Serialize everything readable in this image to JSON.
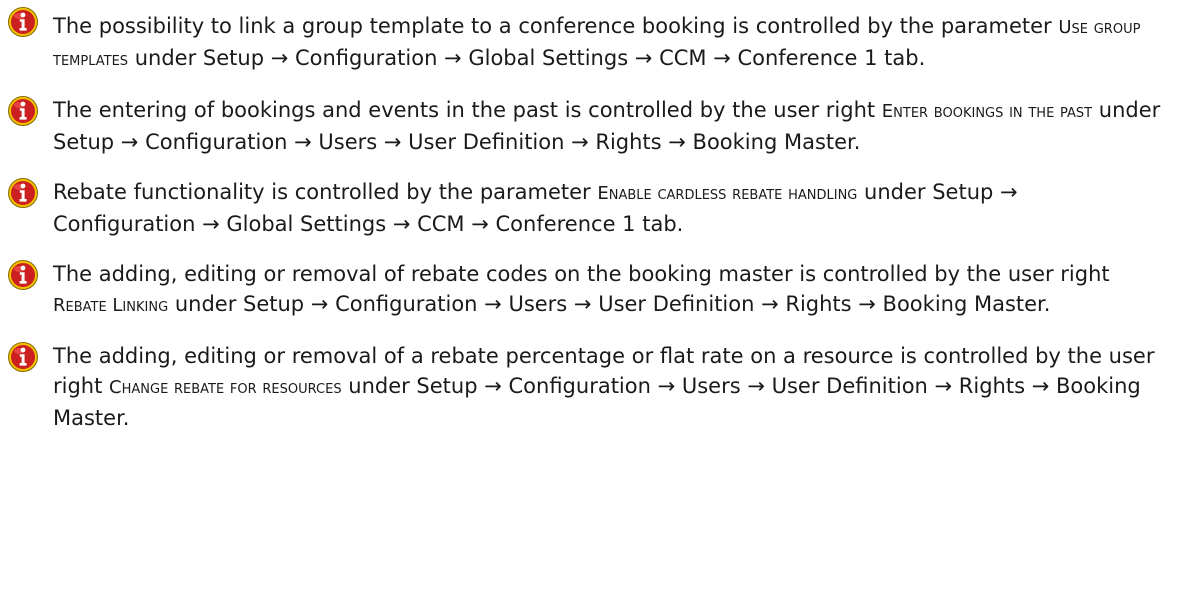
{
  "notes": [
    {
      "icon": "info-icon",
      "before": "The possibility to link a group template to a conference booking is controlled by the parameter ",
      "term": "Use group templates",
      "after": " under Setup → Configuration → Global Settings → CCM → Conference 1 tab."
    },
    {
      "icon": "info-icon",
      "before": "The entering of bookings and events in the past is controlled by the user right ",
      "term": "Enter bookings in the past",
      "after": " under Setup → Configuration → Users → User Definition → Rights → Booking Master."
    },
    {
      "icon": "info-icon",
      "before": "Rebate functionality is controlled by the parameter ",
      "term": "Enable cardless rebate handling",
      "after": " under Setup → Configuration → Global Settings → CCM → Conference 1 tab."
    },
    {
      "icon": "info-icon",
      "before": "The adding, editing or removal of rebate codes on the booking master is controlled by the user right ",
      "term": "Rebate Linking",
      "after": " under Setup → Configuration → Users → User Definition → Rights → Booking Master."
    },
    {
      "icon": "info-icon",
      "before": "The adding, editing or removal of a rebate percentage or flat rate on a resource is controlled by the user right ",
      "term": "Change rebate for resources",
      "after": " under Setup → Configuration → Users → User Definition → Rights → Booking Master."
    }
  ],
  "colors": {
    "icon_fill": "#cc1f1f",
    "icon_ring": "#f2c200",
    "icon_glyph": "#ffffff",
    "text": "#1a1a1a"
  }
}
